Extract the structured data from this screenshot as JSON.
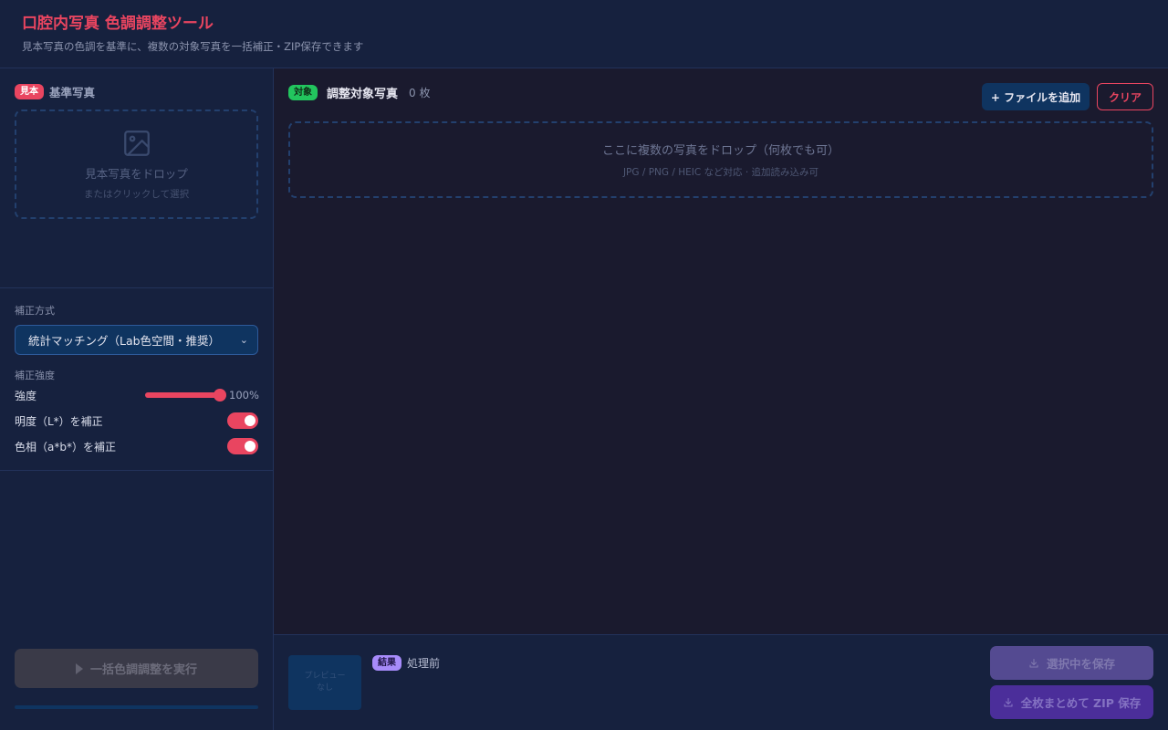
{
  "header": {
    "title": "口腔内写真 色調調整ツール",
    "subtitle": "見本写真の色調を基準に、複数の対象写真を一括補正・ZIP保存できます"
  },
  "reference": {
    "badge": "見本",
    "title": "基準写真",
    "drop_text": "見本写真をドロップ",
    "drop_subtext": "またはクリックして選択"
  },
  "settings": {
    "method_label": "補正方式",
    "method_value": "統計マッチング（Lab色空間・推奨）",
    "strength_section_label": "補正強度",
    "strength_label": "強度",
    "strength_value": "100%",
    "strength_fraction": 1.0,
    "lightness_label": "明度（L*）を補正",
    "lightness_on": true,
    "hue_label": "色相（a*b*）を補正",
    "hue_on": true
  },
  "run": {
    "label": "一括色調調整を実行",
    "progress": 0
  },
  "targets": {
    "badge": "対象",
    "title": "調整対象写真",
    "count": "0 枚",
    "add_label": "+ ファイルを追加",
    "clear_label": "クリア",
    "drop_text": "ここに複数の写真をドロップ（何枚でも可）",
    "drop_subtext": "JPG / PNG / HEIC など対応 · 追加読み込み可"
  },
  "result": {
    "preview_line1": "プレビュー",
    "preview_line2": "なし",
    "badge": "結果",
    "status": "処理前",
    "save_selected_label": "選択中を保存",
    "save_zip_label": "全枚まとめて ZIP 保存"
  },
  "colors": {
    "accent": "#e94560",
    "panel": "#16213e",
    "background": "#1a1a2e",
    "target_badge": "#22c55e",
    "result_badge": "#a78bfa"
  }
}
